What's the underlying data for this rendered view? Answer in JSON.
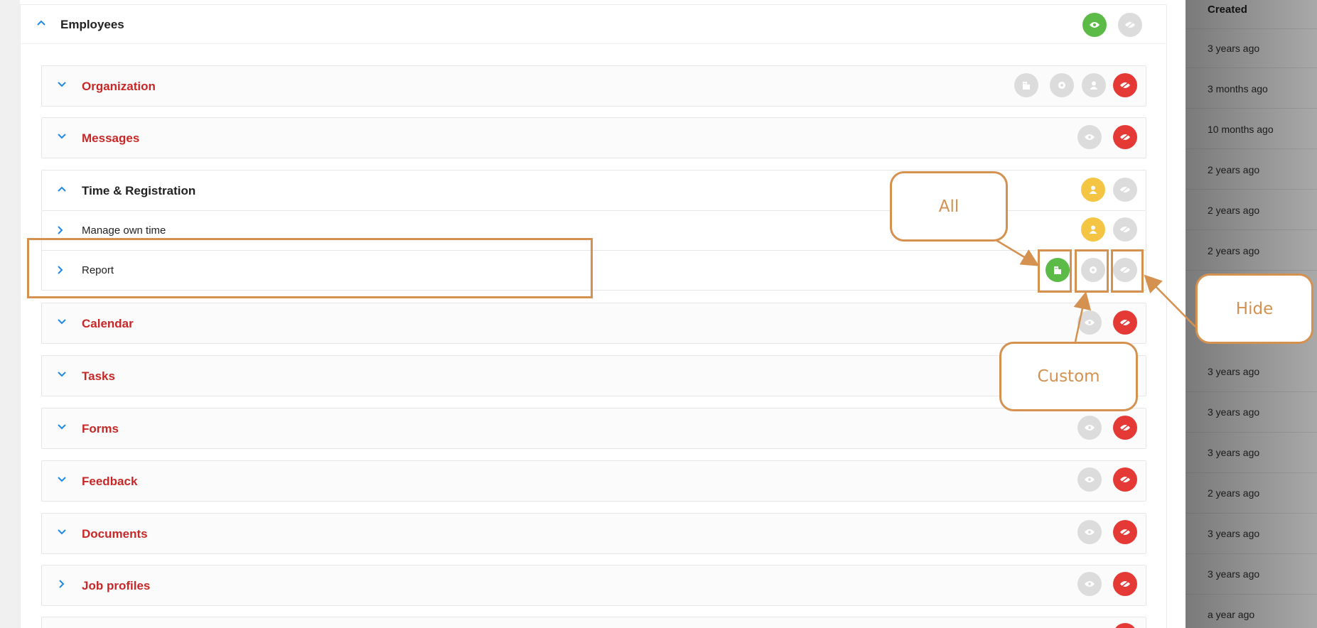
{
  "section": {
    "title": "Employees"
  },
  "rows": [
    {
      "title": "Organization"
    },
    {
      "title": "Messages"
    },
    {
      "title": "Time & Registration"
    },
    {
      "title": "Calendar"
    },
    {
      "title": "Tasks"
    },
    {
      "title": "Forms"
    },
    {
      "title": "Feedback"
    },
    {
      "title": "Documents"
    },
    {
      "title": "Job profiles"
    }
  ],
  "subrows": [
    {
      "label": "Manage own time"
    },
    {
      "label": "Report"
    }
  ],
  "right_column": {
    "header": "Created",
    "values": [
      "3 years ago",
      "3 months ago",
      "10 months ago",
      "2 years ago",
      "2 years ago",
      "2 years ago",
      "3 years ago",
      "3 years ago",
      "3 years ago",
      "2 years ago",
      "3 years ago",
      "3 years ago",
      "a year ago"
    ]
  },
  "annotations": {
    "all": "All",
    "custom": "Custom",
    "hide": "Hide"
  },
  "colors": {
    "accent_red": "#c62828",
    "button_red": "#e53935",
    "button_green": "#5cba47",
    "button_yellow": "#f4c542",
    "button_grey": "#dcdcdc",
    "annotation": "#d4914f"
  },
  "icons": [
    "chevron-up-icon",
    "chevron-down-icon",
    "chevron-right-icon",
    "eye-icon",
    "eye-slash-icon",
    "building-icon",
    "gear-icon",
    "user-icon"
  ]
}
